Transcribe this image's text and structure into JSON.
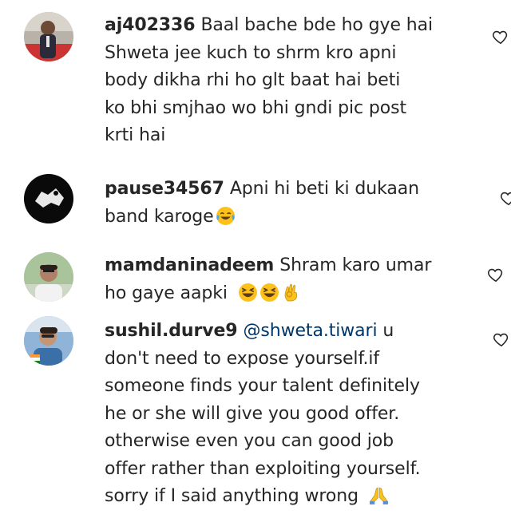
{
  "comments": [
    {
      "username": "aj402336",
      "lines": [
        "Baal bache bde ho gye hai",
        "Shweta jee kuch to shrm kro apni",
        "body dikha rhi ho glt baat hai beti",
        "ko bhi smjhao wo bhi gndi pic post",
        "krti hai"
      ],
      "avatar_icon": "user-avatar-icon",
      "like_icon": "heart-outline-icon"
    },
    {
      "username": "pause34567",
      "lines": [
        "Apni hi beti ki dukaan",
        "band karoge"
      ],
      "emoji": [
        "tears-of-joy-emoji"
      ],
      "avatar_icon": "user-avatar-icon",
      "like_icon": "heart-outline-icon"
    },
    {
      "username": "mamdaninadeem",
      "lines": [
        "Shram karo umar",
        "ho gaye aapki"
      ],
      "emoji": [
        "grinning-squinting-emoji",
        "grinning-squinting-emoji",
        "ok-hand-emoji"
      ],
      "avatar_icon": "user-avatar-icon",
      "like_icon": "heart-outline-icon"
    },
    {
      "username": "sushil.durve9",
      "mention": "@shweta.tiwari",
      "lines": [
        "u",
        "don't need to expose yourself.if",
        "someone finds your talent definitely",
        "he or she will give you good offer.",
        "otherwise even you can good job",
        "offer rather than exploiting yourself.",
        "sorry if I said anything wrong"
      ],
      "emoji": [
        "folded-hands-emoji"
      ],
      "avatar_icon": "user-avatar-icon",
      "like_icon": "heart-outline-icon"
    }
  ],
  "colors": {
    "text": "#262626",
    "mention": "#00376b",
    "background": "#ffffff"
  }
}
